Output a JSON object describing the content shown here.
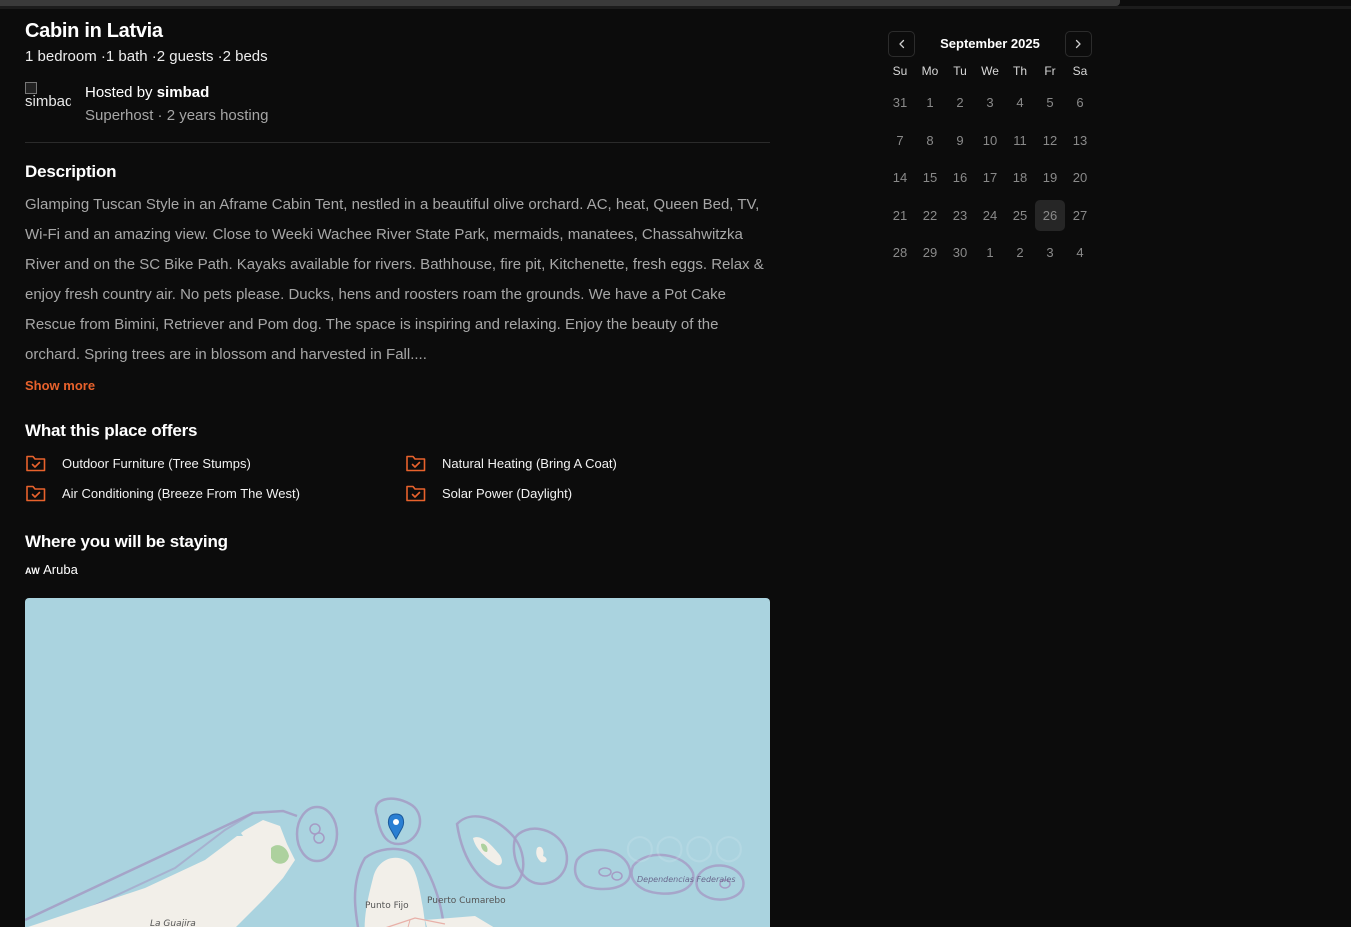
{
  "listing": {
    "title": "Cabin in Latvia",
    "details": "1 bedroom ·1 bath ·2 guests ·2 beds"
  },
  "host": {
    "avatar_alt": "simbad",
    "hosted_by_prefix": "Hosted by ",
    "name": "simbad",
    "meta": "Superhost · 2 years hosting"
  },
  "description": {
    "heading": "Description",
    "text": "Glamping Tuscan Style in an Aframe Cabin Tent, nestled in a beautiful olive orchard. AC, heat, Queen Bed, TV, Wi-Fi and an amazing view. Close to Weeki Wachee River State Park, mermaids, manatees, Chassahwitzka River and on the SC Bike Path. Kayaks available for rivers. Bathhouse, fire pit, Kitchenette, fresh eggs. Relax & enjoy fresh country air. No pets please. Ducks, hens and roosters roam the grounds. We have a Pot Cake Rescue from Bimini, Retriever and Pom dog. The space is inspiring and relaxing. Enjoy the beauty of the orchard. Spring trees are in blossom and harvested in Fall....",
    "show_more": "Show more"
  },
  "offers": {
    "heading": "What this place offers",
    "items": [
      {
        "label": "Outdoor Furniture (Tree Stumps)",
        "icon": "folder-check-icon"
      },
      {
        "label": "Natural Heating (Bring A Coat)",
        "icon": "folder-check-icon"
      },
      {
        "label": "Air Conditioning (Breeze From The West)",
        "icon": "folder-check-icon"
      },
      {
        "label": "Solar Power (Daylight)",
        "icon": "folder-check-icon"
      }
    ]
  },
  "staying": {
    "heading": "Where you will be staying",
    "flag": "AW",
    "country": "Aruba"
  },
  "map": {
    "labels": [
      "La Guajira",
      "Punto Fijo",
      "Puerto Cumarebo",
      "Dependencias Federales"
    ]
  },
  "calendar": {
    "month": "September 2025",
    "prev_icon": "chevron-left-icon",
    "next_icon": "chevron-right-icon",
    "weekdays": [
      "Su",
      "Mo",
      "Tu",
      "We",
      "Th",
      "Fr",
      "Sa"
    ],
    "days": [
      "31",
      "1",
      "2",
      "3",
      "4",
      "5",
      "6",
      "7",
      "8",
      "9",
      "10",
      "11",
      "12",
      "13",
      "14",
      "15",
      "16",
      "17",
      "18",
      "19",
      "20",
      "21",
      "22",
      "23",
      "24",
      "25",
      "26",
      "27",
      "28",
      "29",
      "30",
      "1",
      "2",
      "3",
      "4"
    ],
    "today": "26"
  },
  "colors": {
    "background": "#0c0c0c",
    "accent": "#e8622c",
    "muted_text": "#a7a7a7",
    "map_water": "#aad3df"
  }
}
